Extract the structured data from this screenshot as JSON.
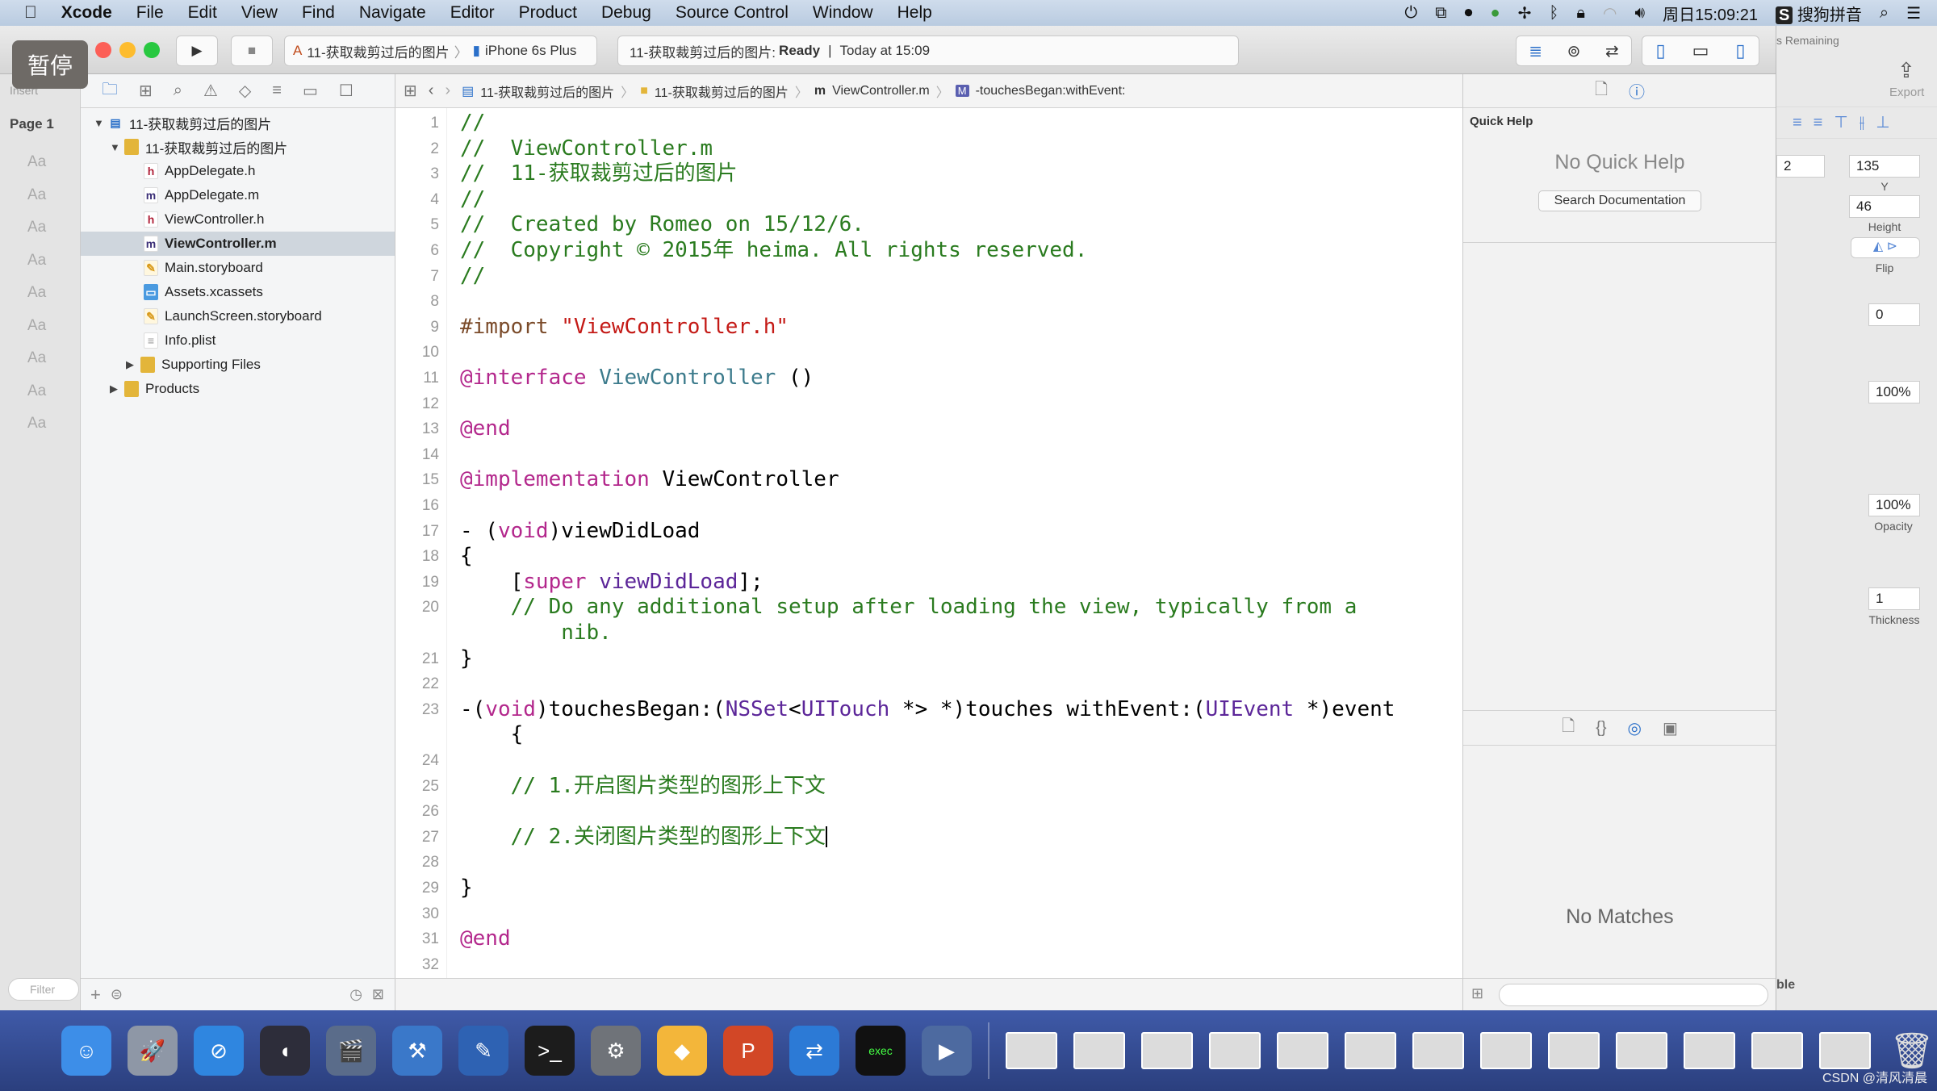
{
  "menubar": {
    "apple_icon": "apple-icon",
    "items": [
      "Xcode",
      "File",
      "Edit",
      "View",
      "Find",
      "Navigate",
      "Editor",
      "Product",
      "Debug",
      "Source Control",
      "Window",
      "Help"
    ],
    "clock": "周日15:09:21",
    "ime": "搜狗拼音"
  },
  "overlay": {
    "pause_label": "暂停"
  },
  "toolbar": {
    "scheme": "11-获取裁剪过后的图片",
    "device": "iPhone 6s Plus",
    "activity_project": "11-获取裁剪过后的图片:",
    "activity_status": "Ready",
    "activity_time": "Today at 15:09"
  },
  "sketch_bg": {
    "insert": "Insert",
    "page": "Page 1",
    "remaining": "s Remaining",
    "export": "Export",
    "x_partial": "2",
    "y_value": "135",
    "y_label": "Y",
    "height_value": "46",
    "height_label": "Height",
    "flip_label": "Flip",
    "rotate_value": "0",
    "opacity1": "100%",
    "opacity2": "100%",
    "opacity_label": "Opacity",
    "thickness_value": "1",
    "thickness_label": "Thickness",
    "table_partial": "ble",
    "aa": "Aa"
  },
  "navigator": {
    "items": [
      {
        "label": "11-获取裁剪过后的图片",
        "icon": "project",
        "level": 0,
        "arrow": "▼"
      },
      {
        "label": "11-获取裁剪过后的图片",
        "icon": "folder",
        "level": 1,
        "arrow": "▼"
      },
      {
        "label": "AppDelegate.h",
        "icon": "h",
        "level": 2
      },
      {
        "label": "AppDelegate.m",
        "icon": "m",
        "level": 2
      },
      {
        "label": "ViewController.h",
        "icon": "h",
        "level": 2
      },
      {
        "label": "ViewController.m",
        "icon": "m",
        "level": 2,
        "selected": true
      },
      {
        "label": "Main.storyboard",
        "icon": "storyboard",
        "level": 2
      },
      {
        "label": "Assets.xcassets",
        "icon": "assets",
        "level": 2
      },
      {
        "label": "LaunchScreen.storyboard",
        "icon": "storyboard",
        "level": 2
      },
      {
        "label": "Info.plist",
        "icon": "plist",
        "level": 2
      },
      {
        "label": "Supporting Files",
        "icon": "folder",
        "level": 1.5,
        "arrow": "▶"
      },
      {
        "label": "Products",
        "icon": "folder",
        "level": 1,
        "arrow": "▶"
      }
    ],
    "filter_placeholder": "Filter"
  },
  "jumpbar": {
    "crumbs": [
      "11-获取裁剪过后的图片",
      "11-获取裁剪过后的图片",
      "ViewController.m",
      "-touchesBegan:withEvent:"
    ]
  },
  "code": {
    "rows": [
      {
        "n": "1",
        "t": [
          [
            "//",
            "c"
          ]
        ]
      },
      {
        "n": "2",
        "t": [
          [
            "//  ViewController.m",
            "c"
          ]
        ]
      },
      {
        "n": "3",
        "t": [
          [
            "//  11-获取裁剪过后的图片",
            "c"
          ]
        ]
      },
      {
        "n": "4",
        "t": [
          [
            "//",
            "c"
          ]
        ]
      },
      {
        "n": "5",
        "t": [
          [
            "//  Created by Romeo on 15/12/6.",
            "c"
          ]
        ]
      },
      {
        "n": "6",
        "t": [
          [
            "//  Copyright © 2015年 heima. All rights reserved.",
            "c"
          ]
        ]
      },
      {
        "n": "7",
        "t": [
          [
            "//",
            "c"
          ]
        ]
      },
      {
        "n": "8",
        "t": []
      },
      {
        "n": "9",
        "t": [
          [
            "#import ",
            "p"
          ],
          [
            "\"ViewController.h\"",
            "s"
          ]
        ]
      },
      {
        "n": "10",
        "t": []
      },
      {
        "n": "11",
        "t": [
          [
            "@interface ",
            "k"
          ],
          [
            "ViewController",
            "t"
          ],
          [
            " ()",
            "n"
          ]
        ]
      },
      {
        "n": "12",
        "t": []
      },
      {
        "n": "13",
        "t": [
          [
            "@end",
            "k"
          ]
        ]
      },
      {
        "n": "14",
        "t": []
      },
      {
        "n": "15",
        "t": [
          [
            "@implementation ",
            "k"
          ],
          [
            "ViewController",
            "n"
          ]
        ]
      },
      {
        "n": "16",
        "t": []
      },
      {
        "n": "17",
        "t": [
          [
            "- (",
            "n"
          ],
          [
            "void",
            "k"
          ],
          [
            ")viewDidLoad",
            "n"
          ]
        ]
      },
      {
        "n": "18",
        "t": [
          [
            "{",
            "n"
          ]
        ]
      },
      {
        "n": "19",
        "t": [
          [
            "    [",
            "n"
          ],
          [
            "super ",
            "k"
          ],
          [
            "viewDidLoad",
            "f"
          ],
          [
            "];",
            "n"
          ]
        ]
      },
      {
        "n": "20",
        "t": [
          [
            "    // Do any additional setup after loading the view, typically from a",
            "c"
          ]
        ]
      },
      {
        "n": "",
        "t": [
          [
            "        nib.",
            "c"
          ]
        ]
      },
      {
        "n": "21",
        "t": [
          [
            "}",
            "n"
          ]
        ]
      },
      {
        "n": "22",
        "t": []
      },
      {
        "n": "23",
        "t": [
          [
            "-(",
            "n"
          ],
          [
            "void",
            "k"
          ],
          [
            ")touchesBegan:(",
            "n"
          ],
          [
            "NSSet",
            "f"
          ],
          [
            "<",
            "n"
          ],
          [
            "UITouch",
            "f"
          ],
          [
            " *> *)touches withEvent:(",
            "n"
          ],
          [
            "UIEvent",
            "f"
          ],
          [
            " *)event",
            "n"
          ]
        ]
      },
      {
        "n": "",
        "t": [
          [
            "    {",
            "n"
          ]
        ]
      },
      {
        "n": "24",
        "t": []
      },
      {
        "n": "25",
        "t": [
          [
            "    // 1.开启图片类型的图形上下文",
            "c"
          ]
        ]
      },
      {
        "n": "26",
        "t": []
      },
      {
        "n": "27",
        "t": [
          [
            "    // 2.关闭图片类型的图形上下文",
            "c"
          ]
        ],
        "caret": true
      },
      {
        "n": "28",
        "t": []
      },
      {
        "n": "29",
        "t": [
          [
            "}",
            "n"
          ]
        ]
      },
      {
        "n": "30",
        "t": []
      },
      {
        "n": "31",
        "t": [
          [
            "@end",
            "k"
          ]
        ]
      },
      {
        "n": "32",
        "t": []
      }
    ]
  },
  "inspector": {
    "title": "Quick Help",
    "no_help": "No Quick Help",
    "search_button": "Search Documentation",
    "no_matches": "No Matches"
  },
  "dock": {
    "apps": [
      {
        "name": "finder",
        "color": "#3d8ee8",
        "glyph": "☺"
      },
      {
        "name": "launchpad",
        "color": "#8e97a6",
        "glyph": "🚀"
      },
      {
        "name": "safari",
        "color": "#2f86e0",
        "glyph": "⊘"
      },
      {
        "name": "mouse",
        "color": "#2d2d3a",
        "glyph": "◖"
      },
      {
        "name": "imovie",
        "color": "#5a6c8a",
        "glyph": "🎬"
      },
      {
        "name": "xcode",
        "color": "#3a78c9",
        "glyph": "⚒"
      },
      {
        "name": "xcode-blue",
        "color": "#2e62b3",
        "glyph": "✎"
      },
      {
        "name": "terminal",
        "color": "#1c1c1c",
        "glyph": ">_"
      },
      {
        "name": "system-preferences",
        "color": "#6f7379",
        "glyph": "⚙"
      },
      {
        "name": "sketch",
        "color": "#f3b63a",
        "glyph": "◆"
      },
      {
        "name": "powerpoint",
        "color": "#d24726",
        "glyph": "P"
      },
      {
        "name": "teamviewer",
        "color": "#2c7ad6",
        "glyph": "⇄"
      },
      {
        "name": "exec",
        "color": "#111",
        "glyph": "exec"
      },
      {
        "name": "quicktime",
        "color": "#4d6aa0",
        "glyph": "▶"
      }
    ],
    "thumb_count": 13,
    "trash": "trash"
  },
  "watermark": "CSDN @清风清晨"
}
